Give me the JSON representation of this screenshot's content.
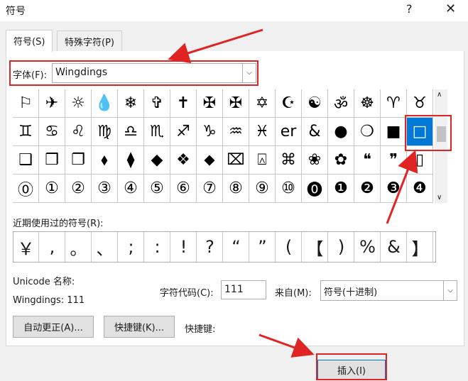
{
  "window": {
    "title": "符号",
    "help": "?",
    "close": "✕"
  },
  "tabs": [
    {
      "label": "符号(S)"
    },
    {
      "label": "特殊字符(P)"
    }
  ],
  "font": {
    "label": "字体(F):",
    "value": "Wingdings",
    "arrow": "⌵"
  },
  "grid": {
    "rows": [
      [
        "⚐",
        "✈",
        "☼",
        "💧",
        "❄",
        "✞",
        "✝",
        "✠",
        "✠",
        "✡",
        "☪",
        "☯",
        "ॐ",
        "☸",
        "♈",
        "♉"
      ],
      [
        "♊",
        "♋",
        "♌",
        "♍",
        "♎",
        "♏",
        "♐",
        "♑",
        "♒",
        "♓",
        "er",
        "&",
        "●",
        "❍",
        "■",
        "□"
      ],
      [
        "❑",
        "❒",
        "❐",
        "⬧",
        "⧫",
        "◆",
        "❖",
        "⬥",
        "⌧",
        "⍓",
        "⌘",
        "❀",
        "✿",
        "❝",
        "❞",
        "▯"
      ],
      [
        "⓪",
        "①",
        "②",
        "③",
        "④",
        "⑤",
        "⑥",
        "⑦",
        "⑧",
        "⑨",
        "⑩",
        "⓿",
        "❶",
        "❷",
        "❸",
        "❹"
      ]
    ],
    "selected_row": 1,
    "selected_col": 15
  },
  "scroll": {
    "up": "∧",
    "down": "∨"
  },
  "recent": {
    "label": "近期使用过的符号(R):",
    "symbols": [
      "￥",
      ",",
      "。",
      "、",
      ";",
      ":",
      "!",
      "?",
      "“",
      "”",
      "(",
      "【",
      ")",
      "%",
      "&",
      "】"
    ]
  },
  "unicode": {
    "label": "Unicode 名称:",
    "value": "Wingdings: 111"
  },
  "char_code": {
    "label": "字符代码(C):",
    "value": "111"
  },
  "from": {
    "label": "来自(M):",
    "value": "符号(十进制)",
    "arrow": "⌵"
  },
  "buttons": {
    "autocorrect": "自动更正(A)...",
    "shortcut_key": "快捷键(K)...",
    "insert": "插入(I)"
  },
  "shortcut_label": "快捷键:",
  "colors": {
    "highlight_red": "#e02424",
    "selection_blue": "#0078d7"
  }
}
